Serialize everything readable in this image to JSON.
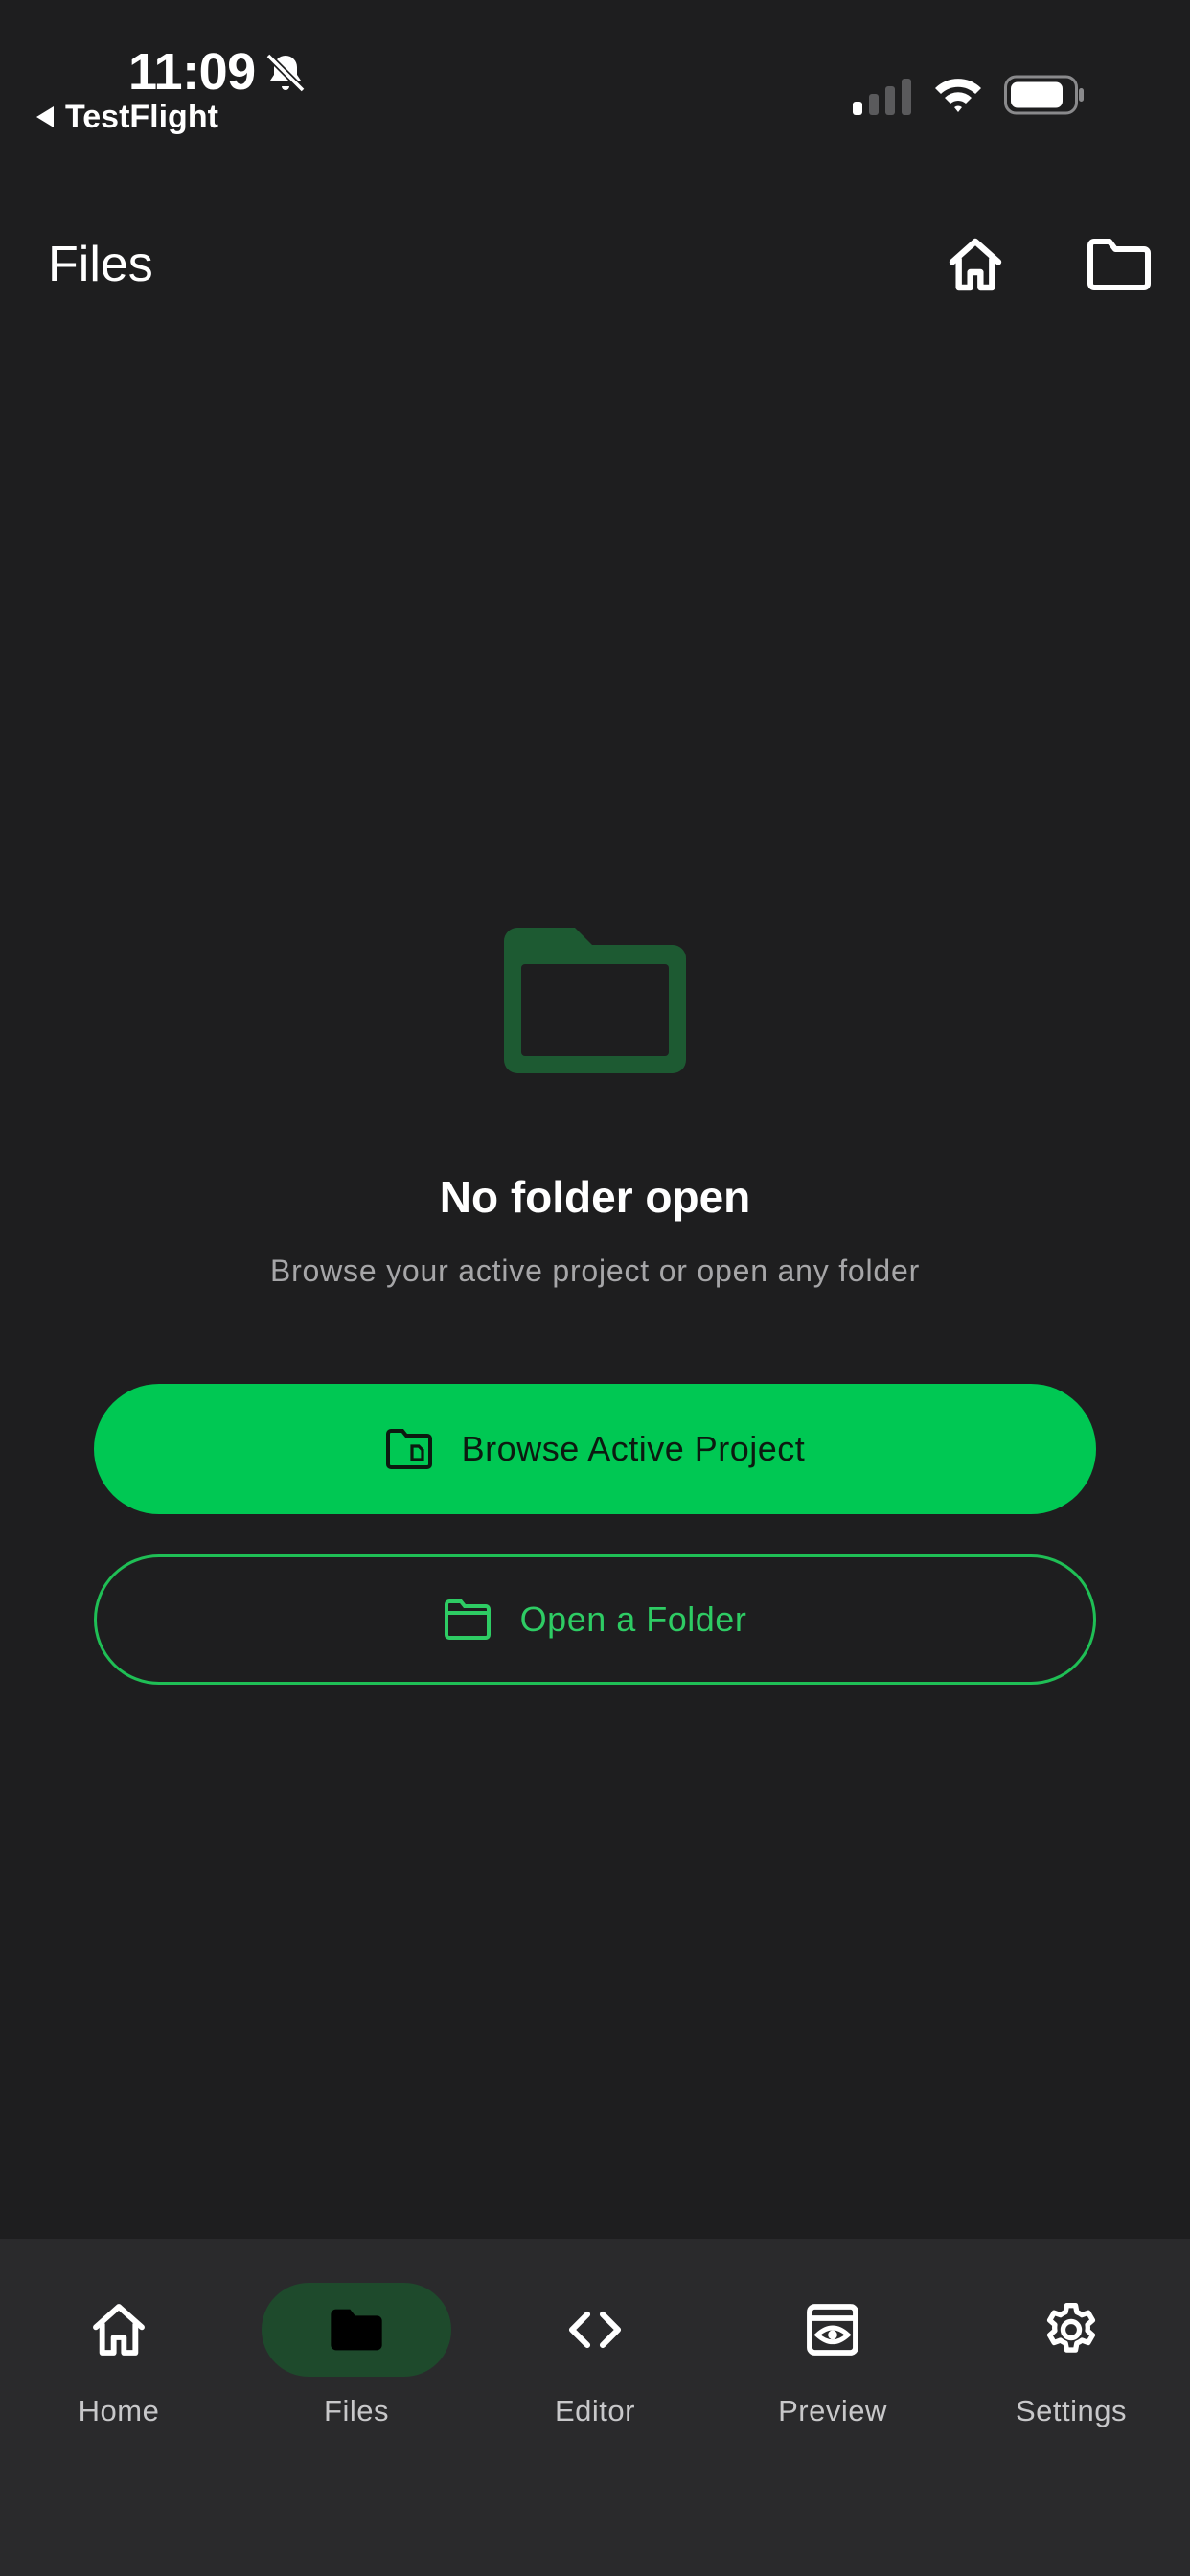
{
  "status_bar": {
    "time": "11:09",
    "back_label": "TestFlight"
  },
  "appbar": {
    "title": "Files"
  },
  "empty_state": {
    "title": "No folder open",
    "subtitle": "Browse your active project or open any folder"
  },
  "actions": {
    "browse_label": "Browse Active Project",
    "open_label": "Open a Folder"
  },
  "nav": {
    "items": [
      {
        "label": "Home",
        "icon": "home-icon"
      },
      {
        "label": "Files",
        "icon": "folder-icon",
        "active": true
      },
      {
        "label": "Editor",
        "icon": "code-icon"
      },
      {
        "label": "Preview",
        "icon": "eye-icon"
      },
      {
        "label": "Settings",
        "icon": "gear-icon"
      }
    ]
  },
  "colors": {
    "background": "#1e1e1f",
    "accent": "#00c853",
    "nav_background": "#2a2a2c",
    "nav_active_pill": "#1e4a2c",
    "empty_icon": "#1d5a32"
  }
}
